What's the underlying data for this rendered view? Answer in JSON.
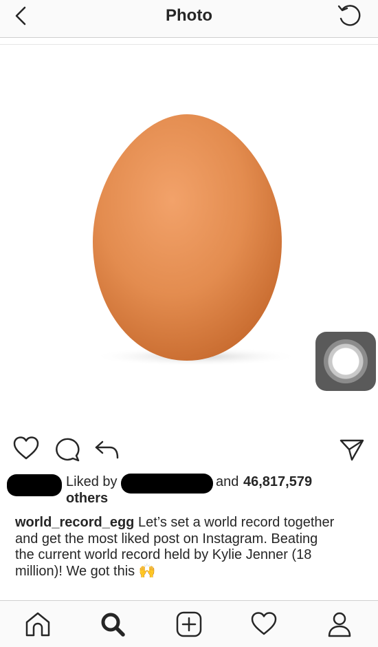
{
  "header": {
    "title": "Photo"
  },
  "post": {
    "photo_subject": "brown egg",
    "liked_by_prefix": "Liked by",
    "likes_and": "and",
    "likes_count": "46,817,579",
    "likes_others": "others",
    "username": "world_record_egg",
    "caption_line1": "Let’s set a world record together",
    "caption_line2": "and get the most liked post on Instagram. Beating",
    "caption_line3": "the current world record held by Kylie Jenner (18",
    "caption_line4": "million)! We got this",
    "caption_emoji": "🙌"
  },
  "icons": {
    "back": "chevron-left-icon",
    "refresh": "rotate-ccw-icon",
    "like": "heart-icon",
    "comment": "comment-bubble-icon",
    "share": "reply-arrow-icon",
    "direct": "paper-plane-icon",
    "tabs": [
      "home-icon",
      "search-icon",
      "add-icon",
      "activity-heart-icon",
      "profile-icon"
    ]
  },
  "colors": {
    "text": "#262626",
    "egg": "#e8955a",
    "header_bg": "#fafafa",
    "assistive_touch": "#5a5a5a"
  }
}
